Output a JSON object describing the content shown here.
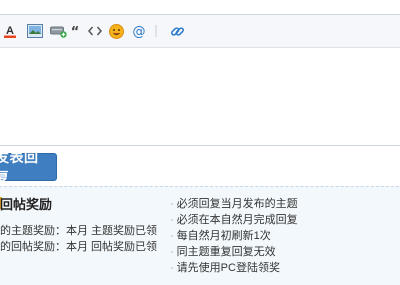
{
  "editor": {
    "toolbar": [
      {
        "icon": "font-color-icon"
      },
      {
        "icon": "image-icon"
      },
      {
        "icon": "attachment-icon"
      },
      {
        "icon": "quote-icon"
      },
      {
        "icon": "code-icon"
      },
      {
        "icon": "emoji-icon"
      },
      {
        "icon": "mention-icon"
      },
      {
        "icon": "link-icon"
      }
    ],
    "textarea_value": ""
  },
  "reply_button": {
    "label": "发表回复"
  },
  "reward": {
    "title": "回帖奖励",
    "topic_reward": "的主题奖励：本月 主题奖励已领",
    "reply_reward": "的回帖奖励：本月 回帖奖励已领",
    "rules": [
      "必须回复当月发布的主题",
      "必须在本自然月完成回复",
      "每自然月初刷新1次",
      "同主题重复回复无效",
      "请先使用PC登陆领奖"
    ]
  },
  "colors": {
    "button_bg": "#3f7ec1",
    "panel_bg": "#f3f8fc",
    "accent_mark": "#e6a21a"
  }
}
